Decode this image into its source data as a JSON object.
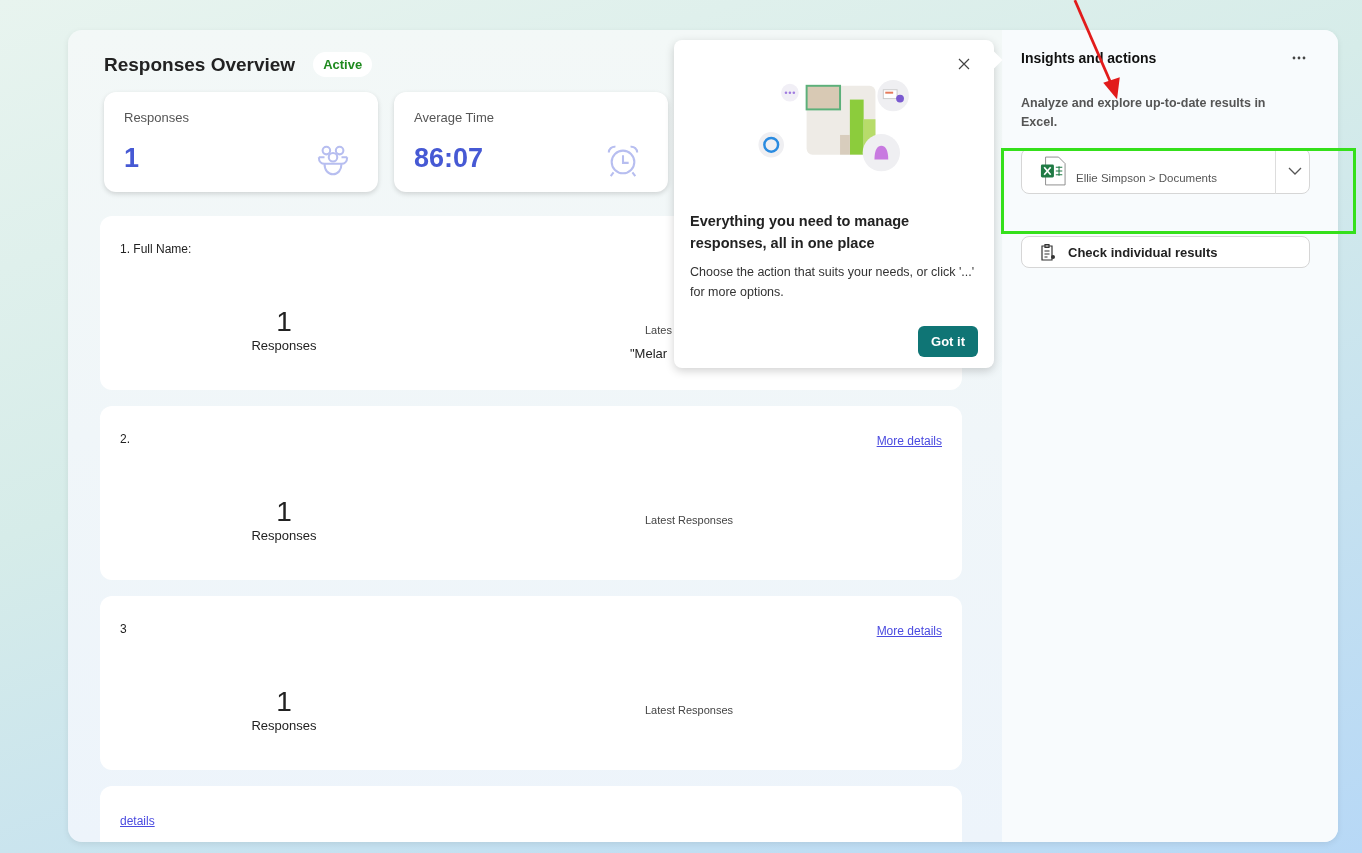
{
  "header": {
    "title": "Responses Overview",
    "status": "Active"
  },
  "stats": [
    {
      "kind": "people",
      "label": "Responses",
      "value": "1"
    },
    {
      "kind": "clock",
      "label": "Average Time",
      "value": "86:07"
    }
  ],
  "questions": [
    {
      "title": "1. Full Name:",
      "count": "1",
      "count_label": "Responses",
      "latest_label": "Lates",
      "latest_value": "\"Melar"
    },
    {
      "title": "2.",
      "link": "More details",
      "count": "1",
      "count_label": "Responses",
      "latest_label": "Latest Responses"
    },
    {
      "title": "3",
      "link": "More details",
      "count": "1",
      "count_label": "Responses",
      "latest_label": "Latest Responses"
    },
    {
      "link": "details"
    }
  ],
  "popup": {
    "heading": "Everything you need to manage responses, all in one place",
    "body": "Choose the action that suits your needs, or click '...' for more options.",
    "button": "Got it"
  },
  "panel": {
    "title": "Insights and actions",
    "description": "Analyze and explore up-to-date results in Excel.",
    "file_path": "Ellie Simpson > Documents",
    "action": "Check individual results"
  }
}
